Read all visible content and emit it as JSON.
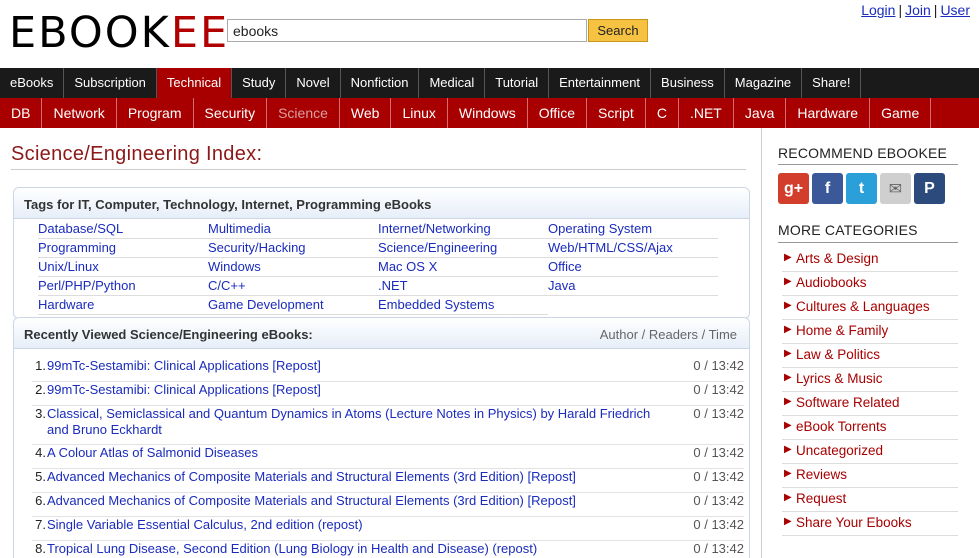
{
  "logo": {
    "part1": "EBOOK",
    "part2": "EE"
  },
  "search": {
    "value": "ebooks",
    "button": "Search"
  },
  "account": {
    "login": "Login",
    "join": "Join",
    "user": "User",
    "sep": "|"
  },
  "nav1": [
    {
      "label": "eBooks"
    },
    {
      "label": "Subscription"
    },
    {
      "label": "Technical",
      "active": true
    },
    {
      "label": "Study"
    },
    {
      "label": "Novel"
    },
    {
      "label": "Nonfiction"
    },
    {
      "label": "Medical"
    },
    {
      "label": "Tutorial"
    },
    {
      "label": "Entertainment"
    },
    {
      "label": "Business"
    },
    {
      "label": "Magazine"
    },
    {
      "label": "Share!"
    }
  ],
  "nav2": [
    {
      "label": "DB"
    },
    {
      "label": "Network"
    },
    {
      "label": "Program"
    },
    {
      "label": "Security"
    },
    {
      "label": "Science",
      "active": true
    },
    {
      "label": "Web"
    },
    {
      "label": "Linux"
    },
    {
      "label": "Windows"
    },
    {
      "label": "Office"
    },
    {
      "label": "Script"
    },
    {
      "label": "C"
    },
    {
      "label": ".NET"
    },
    {
      "label": "Java"
    },
    {
      "label": "Hardware"
    },
    {
      "label": "Game"
    }
  ],
  "page_title": "Science/Engineering Index:",
  "tags_box": {
    "heading": "Tags for IT, Computer, Technology, Internet, Programming eBooks",
    "rows": [
      [
        "Database/SQL",
        "Multimedia",
        "Internet/Networking",
        "Operating System"
      ],
      [
        "Programming",
        "Security/Hacking",
        "Science/Engineering",
        "Web/HTML/CSS/Ajax"
      ],
      [
        "Unix/Linux",
        "Windows",
        "Mac OS X",
        "Office"
      ],
      [
        "Perl/PHP/Python",
        "C/C++",
        ".NET",
        "Java"
      ],
      [
        "Hardware",
        "Game Development",
        "Embedded Systems",
        ""
      ]
    ]
  },
  "recent_box": {
    "heading": "Recently Viewed Science/Engineering eBooks:",
    "columns_label": "Author / Readers / Time",
    "items": [
      {
        "num": "1.",
        "title": "99mTc-Sestamibi: Clinical Applications [Repost]",
        "meta": "0 / 13:42"
      },
      {
        "num": "2.",
        "title": "99mTc-Sestamibi: Clinical Applications [Repost]",
        "meta": "0 / 13:42"
      },
      {
        "num": "3.",
        "title": "Classical, Semiclassical and Quantum Dynamics in Atoms (Lecture Notes in Physics) by Harald Friedrich and Bruno Eckhardt",
        "meta": "0 / 13:42"
      },
      {
        "num": "4.",
        "title": "A Colour Atlas of Salmonid Diseases",
        "meta": "0 / 13:42"
      },
      {
        "num": "5.",
        "title": "Advanced Mechanics of Composite Materials and Structural Elements (3rd Edition) [Repost]",
        "meta": "0 / 13:42"
      },
      {
        "num": "6.",
        "title": "Advanced Mechanics of Composite Materials and Structural Elements (3rd Edition) [Repost]",
        "meta": "0 / 13:42"
      },
      {
        "num": "7.",
        "title": "Single Variable Essential Calculus, 2nd edition (repost)",
        "meta": "0 / 13:42"
      },
      {
        "num": "8.",
        "title": "Tropical Lung Disease, Second Edition (Lung Biology in Health and Disease) (repost)",
        "meta": "0 / 13:42"
      }
    ]
  },
  "sidebar": {
    "recommend_heading": "RECOMMEND EBOOKEE",
    "social": [
      {
        "name": "google-plus",
        "glyph": "g+",
        "color": "#d23e2b"
      },
      {
        "name": "facebook",
        "glyph": "f",
        "color": "#3b5998"
      },
      {
        "name": "twitter",
        "glyph": "t",
        "color": "#2a9fd8"
      },
      {
        "name": "email",
        "glyph": "✉",
        "color": "#cfcfcf"
      },
      {
        "name": "pinterest",
        "glyph": "P",
        "color": "#2c4a7c"
      }
    ],
    "categories_heading": "MORE CATEGORIES",
    "categories": [
      "Arts & Design",
      "Audiobooks",
      "Cultures & Languages",
      "Home & Family",
      "Law & Politics",
      "Lyrics & Music",
      "Software Related",
      "eBook Torrents",
      "Uncategorized",
      "Reviews",
      "Request",
      "Share Your Ebooks"
    ]
  }
}
